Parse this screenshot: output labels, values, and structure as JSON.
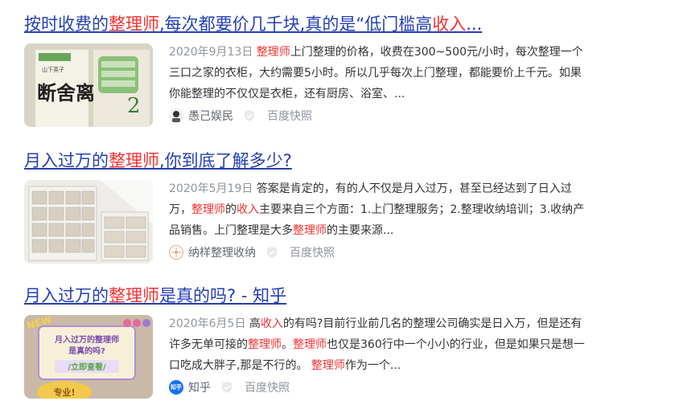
{
  "results": [
    {
      "title": [
        "按时收费的",
        "整理师",
        ",每次都要价几千块,真的是“低门槛高",
        "收入",
        "..."
      ],
      "date": "2020年9月13日",
      "snippet": [
        "",
        "整理师",
        "上门整理的价格，收费在300~500元/小时，每次整理一个三口之家的衣柜，大约需要5小时。所以几乎每次上门整理，都能要价上千元。如果你能整理的不仅仅是衣柜，还有厨房、浴室、..."
      ],
      "source": "愚己娱民",
      "cache": "百度快照",
      "thumb_text": [
        "断舍离",
        "山下英子",
        "2"
      ]
    },
    {
      "title": [
        "月入过万的",
        "整理师",
        ",你到底了解多少?"
      ],
      "date": "2020年5月19日",
      "snippet": [
        "答案是肯定的，有的人不仅是月入过万，甚至已经达到了日入过万，",
        "整理师",
        "的",
        "收入",
        "主要来自三个方面：1.上门整理服务；2.整理收纳培训；3.收纳产品销售。上门整理是大多",
        "整理师",
        "的主要来源..."
      ],
      "source": "纳样整理收纳",
      "cache": "百度快照"
    },
    {
      "title": [
        "月入过万的",
        "整理师",
        "是真的吗? - 知乎"
      ],
      "date": "2020年6月5日",
      "snippet": [
        "高",
        "收入",
        "的有吗?目前行业前几名的整理公司确实是日入万，但是还有许多无单可接的",
        "整理师",
        "。",
        "整理师",
        "也仅是360行中一个小小的行业，但是如果只是想一口吃成大胖子,那是不行的。 ",
        "整理师",
        "作为一个..."
      ],
      "source": "知乎",
      "cache": "百度快照",
      "source_icon_text": "知乎",
      "thumb_text": [
        "NEW",
        "月入过万的整理师",
        "是真的吗?",
        "/立即查看/",
        "专业!"
      ]
    }
  ],
  "colors": {
    "link": "#2440b3",
    "highlight": "#f73131",
    "meta": "#9195a3"
  }
}
